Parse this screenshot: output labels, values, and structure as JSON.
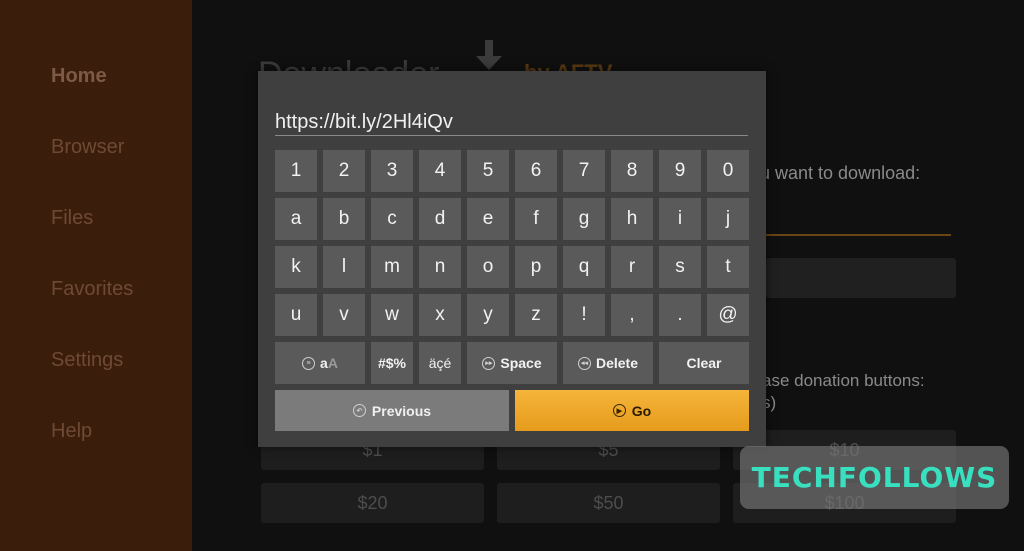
{
  "sidebar": {
    "items": [
      {
        "label": "Home",
        "active": true
      },
      {
        "label": "Browser"
      },
      {
        "label": "Files"
      },
      {
        "label": "Favorites"
      },
      {
        "label": "Settings"
      },
      {
        "label": "Help"
      }
    ]
  },
  "background": {
    "title": "Downloader",
    "brand": "by AFTV",
    "prompt": "u want to download:",
    "donation_text_line1": "ase donation buttons:",
    "donation_text_line2": "s)",
    "donation_buttons": [
      "$1",
      "$5",
      "$10",
      "$20",
      "$50",
      "$100"
    ]
  },
  "dialog": {
    "url_value": "https://bit.ly/2Hl4iQv",
    "rows": [
      [
        "1",
        "2",
        "3",
        "4",
        "5",
        "6",
        "7",
        "8",
        "9",
        "0"
      ],
      [
        "a",
        "b",
        "c",
        "d",
        "e",
        "f",
        "g",
        "h",
        "i",
        "j"
      ],
      [
        "k",
        "l",
        "m",
        "n",
        "o",
        "p",
        "q",
        "r",
        "s",
        "t"
      ],
      [
        "u",
        "v",
        "w",
        "x",
        "y",
        "z",
        "!",
        ",",
        ".",
        "@"
      ]
    ],
    "function_keys": {
      "case_label_lower": "a",
      "case_label_upper": "A",
      "symbols": "#$%",
      "accents": "äçé",
      "space": "Space",
      "delete": "Delete",
      "clear": "Clear"
    },
    "previous_label": "Previous",
    "go_label": "Go"
  },
  "watermark": "TECHFOLLOWS",
  "colors": {
    "sidebar_bg": "#3a1d0b",
    "dialog_bg": "#3f3f3f",
    "key_bg": "#5a5a5a",
    "go_accent": "#f0aa2c"
  }
}
